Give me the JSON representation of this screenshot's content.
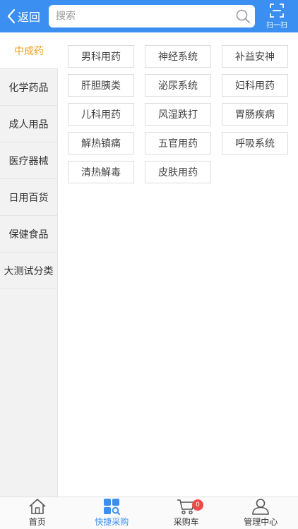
{
  "header": {
    "back_label": "返回",
    "search_placeholder": "搜索",
    "scan_label": "扫一扫"
  },
  "colors": {
    "header_bg": "#3b8ff0",
    "active_category": "#f0a020",
    "active_tab": "#3b8ff0",
    "badge": "#f04848"
  },
  "sidebar": {
    "active_index": 0,
    "items": [
      {
        "label": "中成药"
      },
      {
        "label": "化学药品"
      },
      {
        "label": "成人用品"
      },
      {
        "label": "医疗器械"
      },
      {
        "label": "日用百货"
      },
      {
        "label": "保健食品"
      },
      {
        "label": "大测试分类"
      }
    ]
  },
  "subcategories": [
    {
      "label": "男科用药"
    },
    {
      "label": "神经系统"
    },
    {
      "label": "补益安神"
    },
    {
      "label": "肝胆胰类"
    },
    {
      "label": "泌尿系统"
    },
    {
      "label": "妇科用药"
    },
    {
      "label": "儿科用药"
    },
    {
      "label": "风湿跌打"
    },
    {
      "label": "胃肠疾病"
    },
    {
      "label": "解热镇痛"
    },
    {
      "label": "五官用药"
    },
    {
      "label": "呼吸系统"
    },
    {
      "label": "清热解毒"
    },
    {
      "label": "皮肤用药"
    }
  ],
  "bottom_nav": {
    "active_index": 1,
    "items": [
      {
        "label": "首页",
        "icon": "home-icon"
      },
      {
        "label": "快捷采购",
        "icon": "quick-purchase-icon"
      },
      {
        "label": "采购车",
        "icon": "cart-icon"
      },
      {
        "label": "管理中心",
        "icon": "user-icon"
      }
    ],
    "cart_badge": "0"
  }
}
